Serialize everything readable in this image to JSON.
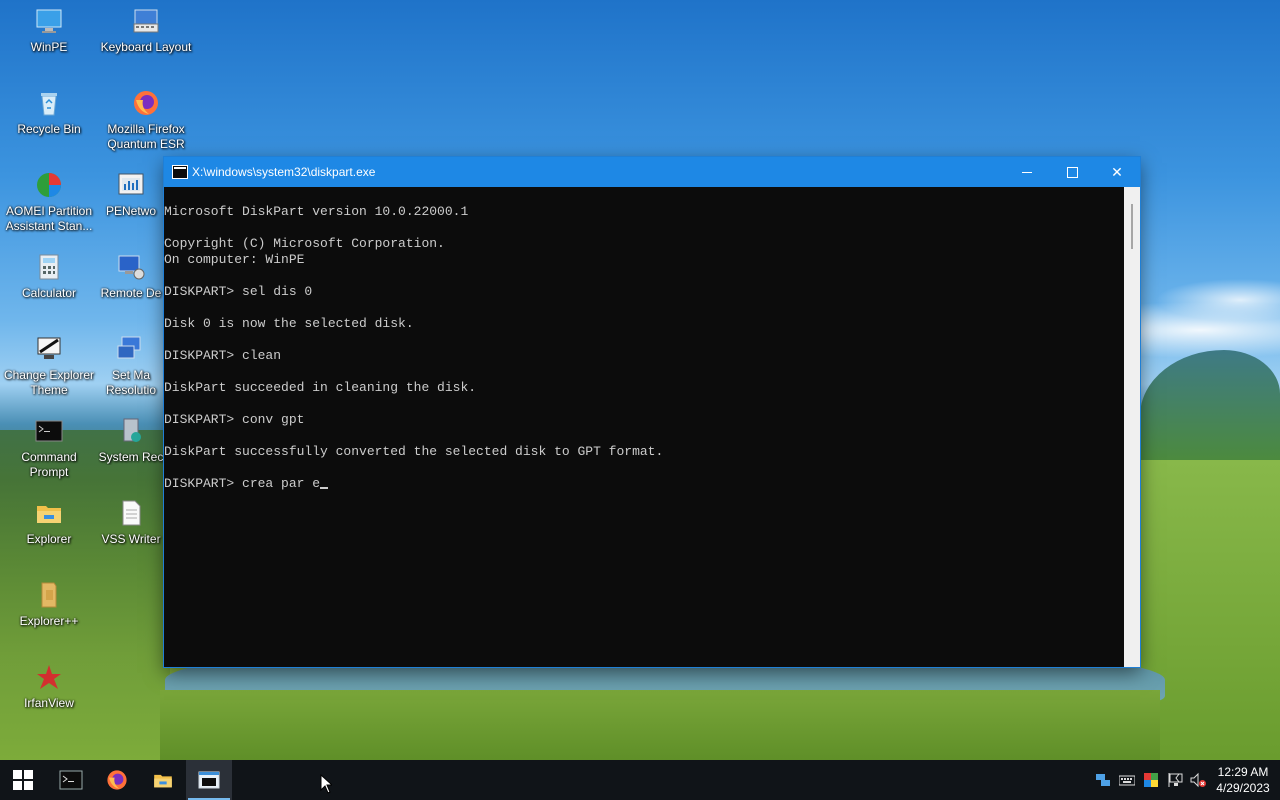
{
  "desktop": {
    "icons": [
      {
        "label": "WinPE",
        "icon": "monitor-icon"
      },
      {
        "label": "Keyboard Layout",
        "icon": "keyboard-icon"
      },
      {
        "label": "Recycle Bin",
        "icon": "recycle-bin-icon"
      },
      {
        "label": "Mozilla Firefox Quantum ESR",
        "icon": "firefox-icon"
      },
      {
        "label": "AOMEI Partition Assistant Stan...",
        "icon": "aomei-icon"
      },
      {
        "label": "PENetwo",
        "icon": "network-icon"
      },
      {
        "label": "Calculator",
        "icon": "calculator-icon"
      },
      {
        "label": "Remote De",
        "icon": "remote-desktop-icon"
      },
      {
        "label": "Change Explorer Theme",
        "icon": "theme-icon"
      },
      {
        "label": "Set Ma Resolutio",
        "icon": "resolution-icon"
      },
      {
        "label": "Command Prompt",
        "icon": "cmd-icon"
      },
      {
        "label": "System Rec",
        "icon": "system-recovery-icon"
      },
      {
        "label": "Explorer",
        "icon": "folder-icon"
      },
      {
        "label": "VSS Writer",
        "icon": "document-icon"
      },
      {
        "label": "Explorer++",
        "icon": "explorerpp-icon"
      },
      {
        "label": "IrfanView",
        "icon": "irfanview-icon"
      }
    ]
  },
  "console": {
    "title": "X:\\windows\\system32\\diskpart.exe",
    "lines": [
      "Microsoft DiskPart version 10.0.22000.1",
      "",
      "Copyright (C) Microsoft Corporation.",
      "On computer: WinPE",
      "",
      "DISKPART> sel dis 0",
      "",
      "Disk 0 is now the selected disk.",
      "",
      "DISKPART> clean",
      "",
      "DiskPart succeeded in cleaning the disk.",
      "",
      "DISKPART> conv gpt",
      "",
      "DiskPart successfully converted the selected disk to GPT format.",
      "",
      "DISKPART> crea par e"
    ],
    "colors": {
      "background": "#0c0c0c",
      "text": "#cccccc",
      "titlebar": "#1e88e5"
    }
  },
  "taskbar": {
    "buttons": [
      {
        "name": "start-button",
        "icon": "windows-logo-icon"
      },
      {
        "name": "cmd-taskbar-button",
        "icon": "cmd-icon"
      },
      {
        "name": "firefox-taskbar-button",
        "icon": "firefox-icon"
      },
      {
        "name": "explorer-taskbar-button",
        "icon": "folder-icon"
      },
      {
        "name": "diskpart-taskbar-button",
        "icon": "console-window-icon",
        "active": true
      }
    ],
    "tray_icons": [
      "network-adapter-icon",
      "keyboard-icon",
      "color-icon",
      "notification-flag-icon",
      "network-icon",
      "volume-muted-icon"
    ],
    "time": "12:29 AM",
    "date": "4/29/2023"
  }
}
